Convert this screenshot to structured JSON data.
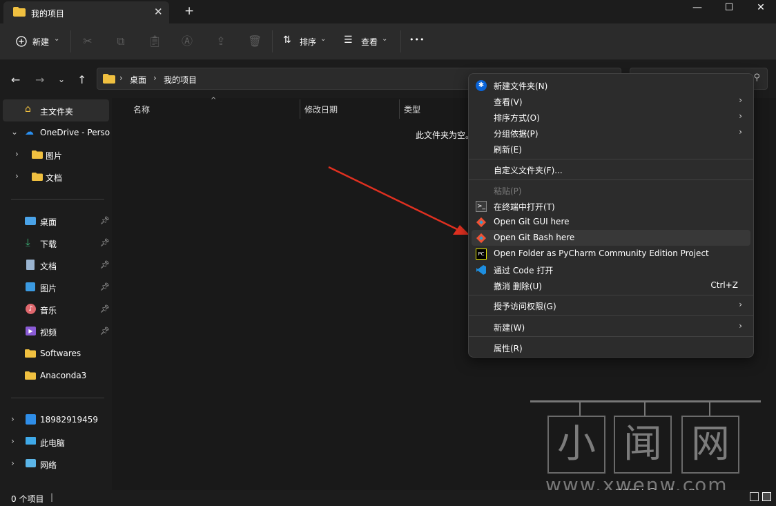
{
  "window": {
    "tab_title": "我的项目",
    "close_tab": "✕",
    "new_tab": "+",
    "minimize": "—",
    "maximize": "☐",
    "close": "✕"
  },
  "toolbar": {
    "new_label": "新建",
    "sort_label": "排序",
    "view_label": "查看",
    "more_label": "•••"
  },
  "address": {
    "crumbs": [
      "桌面",
      "我的项目"
    ]
  },
  "sidebar": {
    "home": "主文件夹",
    "onedrive": "OneDrive - Perso",
    "pictures_od": "图片",
    "docs_od": "文档",
    "desktop": "桌面",
    "downloads": "下载",
    "documents": "文档",
    "pictures": "图片",
    "music": "音乐",
    "videos": "视频",
    "softwares": "Softwares",
    "anaconda": "Anaconda3",
    "phone": "18982919459",
    "thispc": "此电脑",
    "network": "网络"
  },
  "columns": {
    "name": "名称",
    "modified": "修改日期",
    "type": "类型"
  },
  "main": {
    "empty_text": "此文件夹为空。"
  },
  "status": {
    "count": "0 个项目"
  },
  "context_menu": {
    "new_folder": "新建文件夹(N)",
    "view": "查看(V)",
    "sort": "排序方式(O)",
    "group": "分组依据(P)",
    "refresh": "刷新(E)",
    "customize": "自定义文件夹(F)...",
    "paste": "粘贴(P)",
    "terminal": "在终端中打开(T)",
    "git_gui": "Open Git GUI here",
    "git_bash": "Open Git Bash here",
    "pycharm": "Open Folder as PyCharm Community Edition Project",
    "vscode": "通过 Code 打开",
    "undo": "撤消 删除(U)",
    "undo_shortcut": "Ctrl+Z",
    "access": "授予访问权限(G)",
    "new": "新建(W)",
    "properties": "属性(R)"
  },
  "watermark": {
    "chars": [
      "小",
      "闻",
      "网"
    ],
    "url": "www.xwenw.com",
    "credit": "CSDN @pythonSuperman"
  },
  "colors": {
    "accent_blue": "#0a64d8",
    "folder_yellow": "#f0c040",
    "arrow_red": "#e03020",
    "git_orange": "#f05133",
    "menu_bg": "#2c2c2c"
  }
}
